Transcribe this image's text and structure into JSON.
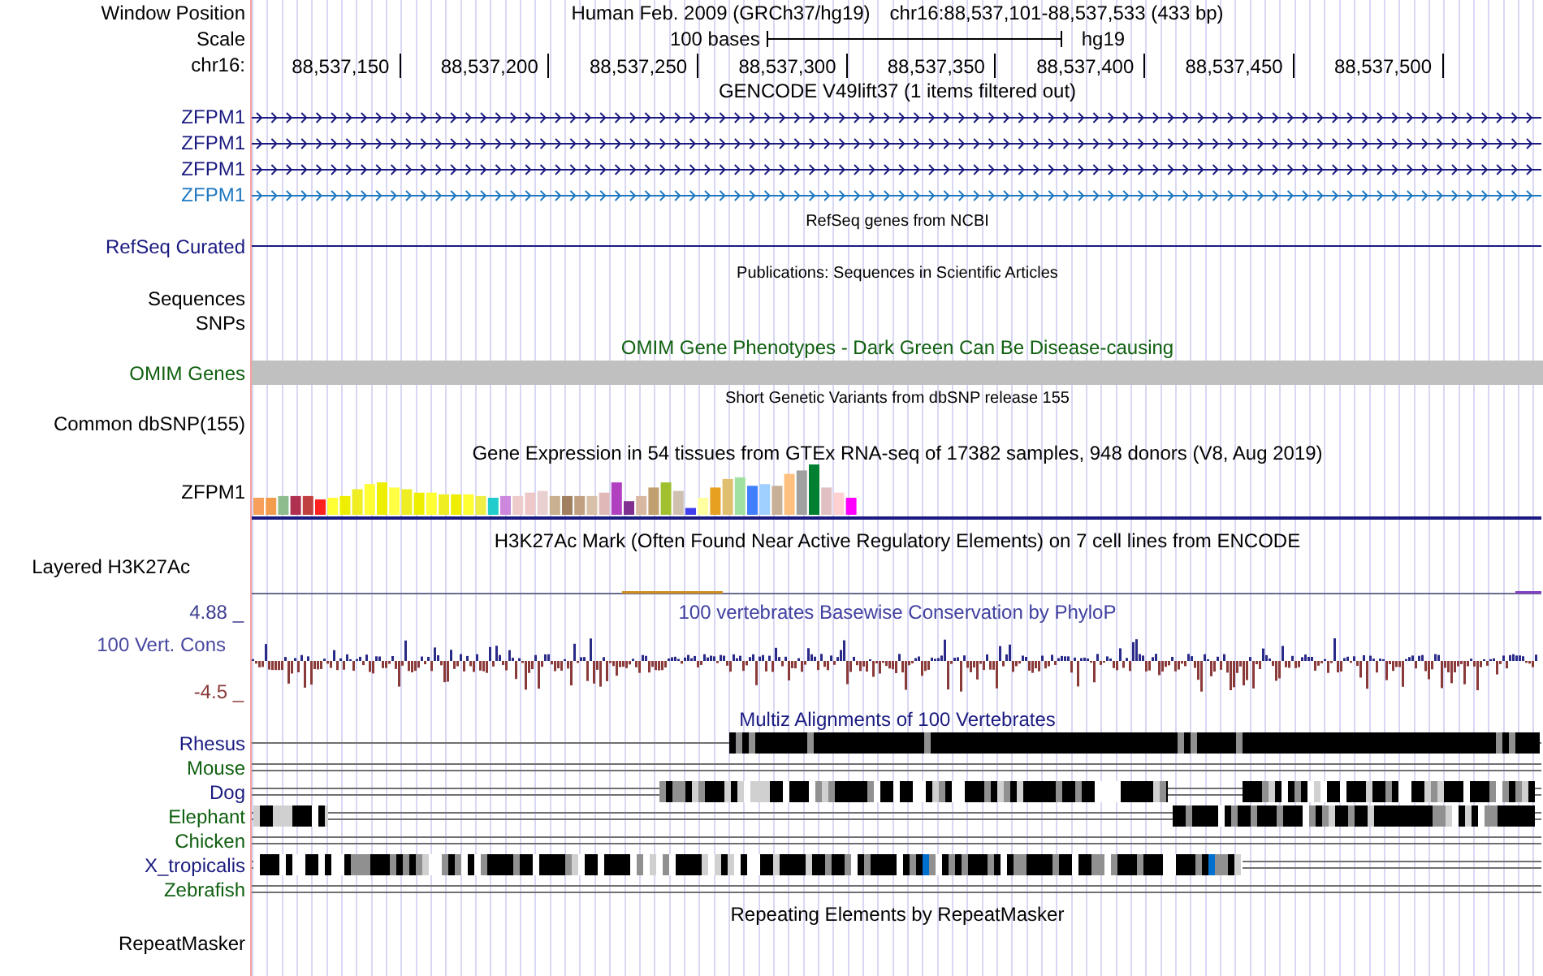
{
  "header": {
    "position_label": "Window Position",
    "assembly": "Human Feb. 2009 (GRCh37/hg19)",
    "position": "chr16:88,537,101-88,537,533 (433 bp)",
    "scale_label": "Scale",
    "scale_text": "100 bases",
    "scale_db": "hg19",
    "chrom_label": "chr16:",
    "ticks": [
      "88,537,150",
      "88,537,200",
      "88,537,250",
      "88,537,300",
      "88,537,350",
      "88,537,400",
      "88,537,450",
      "88,537,500"
    ]
  },
  "tracks": [
    {
      "kind": "genes",
      "title": "GENCODE V49lift37 (1 items filtered out)",
      "items": [
        {
          "label": "ZFPM1",
          "color": "#1a1a80"
        },
        {
          "label": "ZFPM1",
          "color": "#1a1a80"
        },
        {
          "label": "ZFPM1",
          "color": "#1a1a80"
        },
        {
          "label": "ZFPM1",
          "color": "#1f78c0"
        }
      ]
    },
    {
      "kind": "refseq",
      "title": "RefSeq genes from NCBI",
      "items": [
        {
          "label": "RefSeq Curated"
        }
      ]
    },
    {
      "kind": "annotation",
      "title": "Publications: Sequences in Scientific Articles",
      "items": [
        {
          "label": "Sequences"
        },
        {
          "label": "SNPs"
        }
      ]
    },
    {
      "kind": "omim",
      "title": "OMIM Gene Phenotypes - Dark Green Can Be Disease-causing",
      "items": [
        {
          "label": "OMIM Genes"
        }
      ]
    },
    {
      "kind": "annotation",
      "title": "Short Genetic Variants from dbSNP release 155",
      "items": [
        {
          "label": "Common dbSNP(155)"
        }
      ]
    },
    {
      "kind": "expression",
      "title": "Gene Expression in 54 tissues from GTEx RNA-seq of 17382 samples, 948 donors (V8, Aug 2019)",
      "items": [
        {
          "label": "ZFPM1"
        }
      ]
    },
    {
      "kind": "signal",
      "title": "H3K27Ac Mark (Often Found Near Active Regulatory Elements) on 7 cell lines from ENCODE",
      "items": [
        {
          "label": "Layered H3K27Ac"
        }
      ]
    },
    {
      "kind": "wiggle",
      "title": "100 vertebrates Basewise Conservation by PhyloP",
      "items": [
        {
          "label": "100 Vert. Cons"
        }
      ],
      "ymax": "4.88 _",
      "ymin": "-4.5 _"
    },
    {
      "kind": "alignment",
      "title": "Multiz Alignments of 100 Vertebrates",
      "items": [
        {
          "label": "Rhesus",
          "color": "#1a1a80"
        },
        {
          "label": "Mouse",
          "color": "#106010"
        },
        {
          "label": "Dog",
          "color": "#1a1a80"
        },
        {
          "label": "Elephant",
          "color": "#106010"
        },
        {
          "label": "Chicken",
          "color": "#106010"
        },
        {
          "label": "X_tropicalis",
          "color": "#1a1a80"
        },
        {
          "label": "Zebrafish",
          "color": "#106010"
        }
      ]
    },
    {
      "kind": "repeat",
      "title": "Repeating Elements by RepeatMasker",
      "items": [
        {
          "label": "RepeatMasker"
        }
      ]
    }
  ]
}
